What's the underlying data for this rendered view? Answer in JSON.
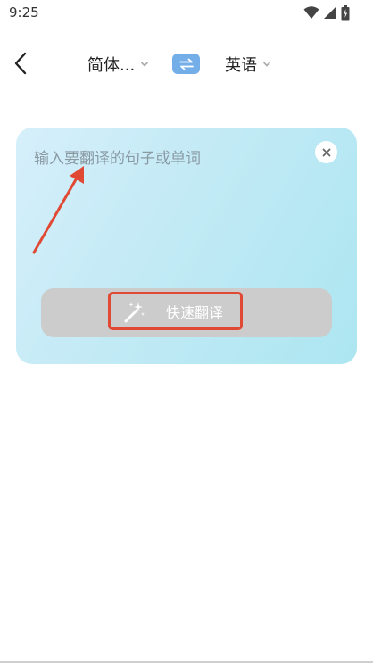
{
  "status_bar": {
    "time": "9:25",
    "icons": [
      "wifi-icon",
      "signal-icon",
      "battery-icon"
    ]
  },
  "top_bar": {
    "back_icon": "back-arrow-icon",
    "source_language": "简体...",
    "target_language": "英语",
    "swap_icon": "swap-arrows-icon"
  },
  "input_card": {
    "placeholder": "输入要翻译的句子或单词",
    "clear_icon": "close-icon",
    "translate_button_label": "快速翻译",
    "translate_button_icon": "magic-wand-icon"
  },
  "colors": {
    "swap_button": "#74aee8",
    "card_gradient_start": "#d6effb",
    "card_gradient_end": "#ace6f1",
    "translate_button_bg": "#cccccc",
    "annotation_red": "#e04a35"
  }
}
